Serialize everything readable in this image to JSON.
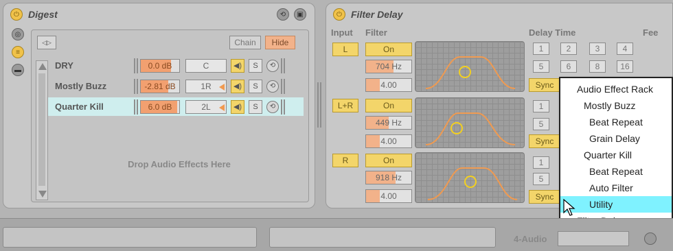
{
  "digest": {
    "title": "Digest",
    "chain_label": "Chain",
    "hide_label": "Hide",
    "drop_hint": "Drop Audio Effects Here",
    "chains": [
      {
        "name": "DRY",
        "volume": "0.0 dB",
        "volume_fill": 0.78,
        "pan": "C",
        "solo": "S",
        "highlighted": false
      },
      {
        "name": "Mostly Buzz",
        "volume": "-2.81 dB",
        "volume_fill": 0.72,
        "pan": "1R",
        "solo": "S",
        "highlighted": false
      },
      {
        "name": "Quarter Kill",
        "volume": "6.0 dB",
        "volume_fill": 0.95,
        "pan": "2L",
        "solo": "S",
        "highlighted": true
      }
    ]
  },
  "filter_delay": {
    "title": "Filter Delay",
    "input_label": "Input",
    "filter_label": "Filter",
    "delay_time_label": "Delay Time",
    "feedback_label": "Fee",
    "channels": [
      {
        "input": "L",
        "on": "On",
        "freq": "704 Hz",
        "freq_fill": 0.6,
        "q": "4.00",
        "q_fill": 0.3
      },
      {
        "input": "L+R",
        "on": "On",
        "freq": "449 Hz",
        "freq_fill": 0.5,
        "q": "4.00",
        "q_fill": 0.3
      },
      {
        "input": "R",
        "on": "On",
        "freq": "918 Hz",
        "freq_fill": 0.65,
        "q": "4.00",
        "q_fill": 0.3
      }
    ],
    "delay_row1": [
      "1",
      "2",
      "3",
      "4"
    ],
    "delay_row2": [
      "5",
      "6",
      "8",
      "16"
    ],
    "delay_selected": "3",
    "sync_label": "Sync",
    "ch2_delays": [
      "1",
      "5"
    ],
    "ch3_delays": [
      "1",
      "5"
    ]
  },
  "context_menu": {
    "items": [
      {
        "label": "Audio Effect Rack",
        "indent": 0
      },
      {
        "label": "Mostly Buzz",
        "indent": 1
      },
      {
        "label": "Beat Repeat",
        "indent": 2
      },
      {
        "label": "Grain Delay",
        "indent": 2
      },
      {
        "label": "Quarter Kill",
        "indent": 1
      },
      {
        "label": "Beat Repeat",
        "indent": 2
      },
      {
        "label": "Auto Filter",
        "indent": 2
      },
      {
        "label": "Utility",
        "indent": 2,
        "selected": true
      },
      {
        "label": "Filter Delay",
        "indent": 0
      }
    ]
  },
  "bottom": {
    "track_label": "4-Audio"
  },
  "colors": {
    "accent_yellow": "#f3d56a",
    "accent_orange": "#f2a070",
    "menu_selected": "#7ff2ff",
    "chain_selected": "#cfeeee"
  }
}
